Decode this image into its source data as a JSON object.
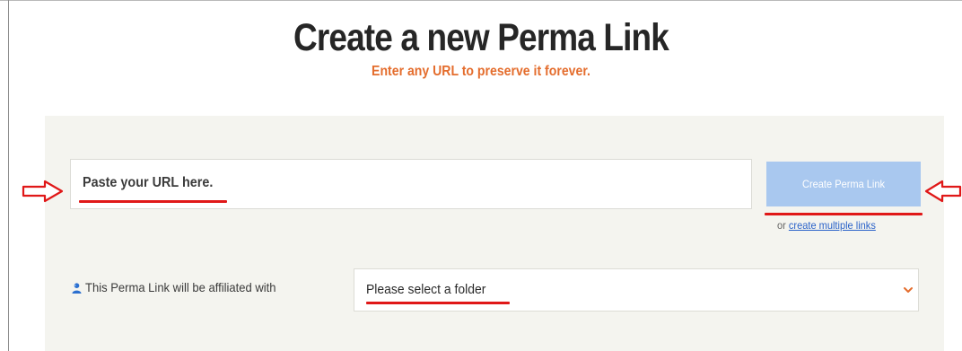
{
  "header": {
    "title": "Create a new Perma Link",
    "subtitle": "Enter any URL to preserve it forever."
  },
  "form": {
    "url_placeholder": "Paste your URL here.",
    "create_button_label": "Create Perma Link",
    "multi_prefix": "or",
    "multi_link_label": "create multiple links",
    "affiliation_label": "This Perma Link will be affiliated with",
    "affiliation_icon": "user-icon",
    "folder_selected": "Please select a folder",
    "folder_chevron_icon": "chevron-down-icon"
  },
  "annotations": {
    "left_arrow_icon": "arrow-right-outline-icon",
    "right_arrow_icon": "arrow-left-outline-icon"
  },
  "colors": {
    "subtitle": "#e46d2d",
    "button_bg": "#a9c8ef",
    "panel_bg": "#f4f4ef",
    "link": "#2a62c9",
    "annotation_red": "#e01818"
  }
}
